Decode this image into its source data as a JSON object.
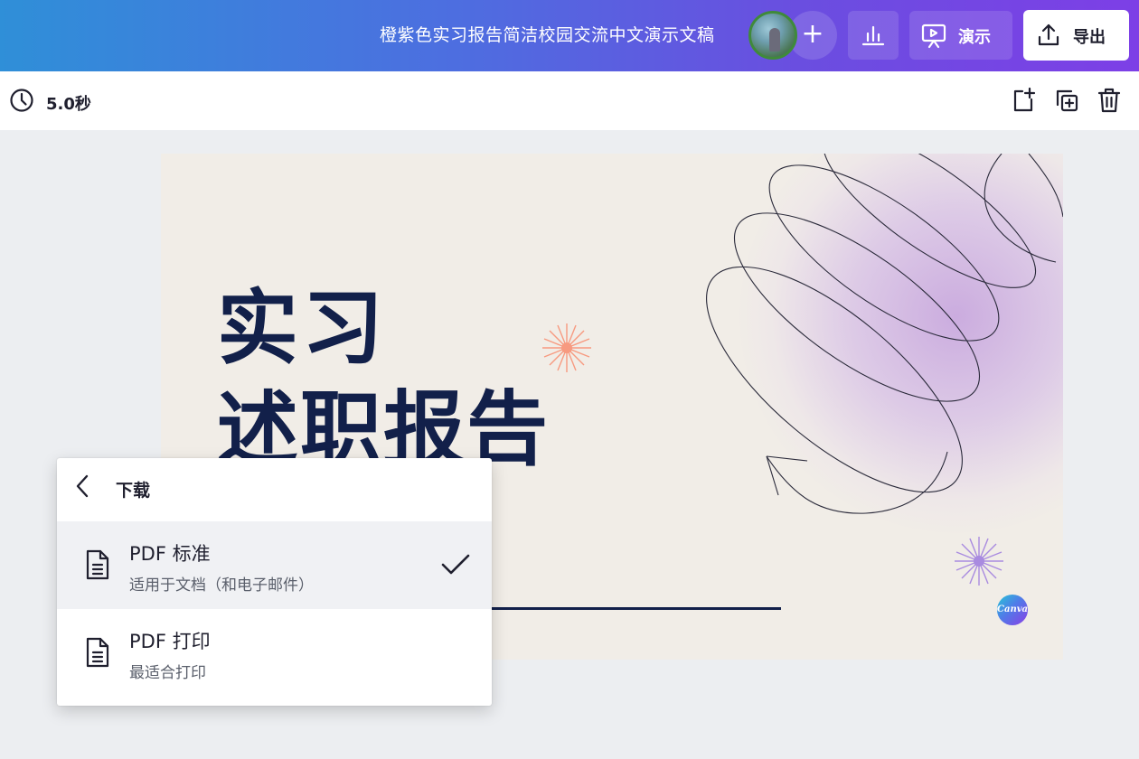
{
  "header": {
    "doc_title": "橙紫色实习报告简洁校园交流中文演示文稿",
    "add_collaborator_label": "+",
    "present_label": "演示",
    "export_label": "导出",
    "colors": {
      "gradient_start": "#2f8fd8",
      "gradient_end": "#7d3fe6"
    }
  },
  "toolbar": {
    "duration": "5.0秒"
  },
  "slide": {
    "title_line1": "实习",
    "title_line2": "述职报告",
    "brand_badge": "Canva",
    "colors": {
      "background": "#f1ede7",
      "title": "#12204a",
      "accent_orange": "#f79a80",
      "accent_purple": "#a98be0"
    }
  },
  "download_panel": {
    "title": "下载",
    "options": [
      {
        "name": "PDF 标准",
        "description": "适用于文档（和电子邮件）",
        "selected": true
      },
      {
        "name": "PDF 打印",
        "description": "最适合打印",
        "selected": false
      }
    ]
  },
  "icons": [
    "clock-icon",
    "analytics-icon",
    "present-icon",
    "export-icon",
    "add-page-icon",
    "duplicate-page-icon",
    "trash-icon",
    "back-arrow-icon",
    "document-icon",
    "checkmark-icon"
  ]
}
